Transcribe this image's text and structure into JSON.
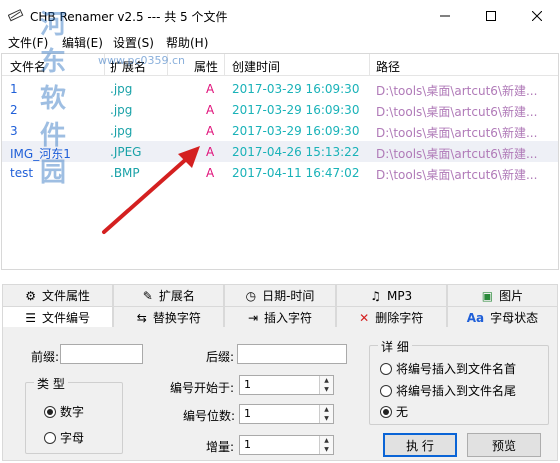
{
  "window": {
    "title": "CHB Renamer v2.5 --- 共 5 个文件",
    "minimize": "—",
    "maximize": "☐",
    "close": "✕"
  },
  "menu": [
    {
      "label": "文件(F)"
    },
    {
      "label": "编辑(E)"
    },
    {
      "label": "设置(S)"
    },
    {
      "label": "帮助(H)"
    }
  ],
  "watermark": {
    "text": "河东软件园",
    "url": "www.pc0359.cn"
  },
  "file_list": {
    "columns": [
      "文件名",
      "扩展名",
      "属性",
      "创建时间",
      "路径"
    ],
    "rows": [
      {
        "name": "1",
        "ext": ".jpg",
        "attr": "A",
        "created": "2017-03-29 16:09:30",
        "path": "D:\\tools\\桌面\\artcut6\\新建..."
      },
      {
        "name": "2",
        "ext": ".jpg",
        "attr": "A",
        "created": "2017-03-29 16:09:30",
        "path": "D:\\tools\\桌面\\artcut6\\新建..."
      },
      {
        "name": "3",
        "ext": ".jpg",
        "attr": "A",
        "created": "2017-03-29 16:09:30",
        "path": "D:\\tools\\桌面\\artcut6\\新建..."
      },
      {
        "name": "IMG_河东1",
        "ext": ".JPEG",
        "attr": "A",
        "created": "2017-04-26 15:13:22",
        "path": "D:\\tools\\桌面\\artcut6\\新建..."
      },
      {
        "name": "test",
        "ext": ".BMP",
        "attr": "A",
        "created": "2017-04-11 16:47:02",
        "path": "D:\\tools\\桌面\\artcut6\\新建..."
      }
    ]
  },
  "tabs_top": [
    {
      "label": "文件属性",
      "icon": "gear-icon"
    },
    {
      "label": "扩展名",
      "icon": "edit-icon"
    },
    {
      "label": "日期-时间",
      "icon": "clock-icon"
    },
    {
      "label": "MP3",
      "icon": "music-icon"
    },
    {
      "label": "图片",
      "icon": "picture-icon"
    }
  ],
  "tabs_bottom": [
    {
      "label": "文件编号",
      "icon": "list-icon",
      "active": true
    },
    {
      "label": "替换字符",
      "icon": "replace-icon"
    },
    {
      "label": "插入字符",
      "icon": "insert-icon"
    },
    {
      "label": "删除字符",
      "icon": "delete-icon"
    },
    {
      "label": "字母状态",
      "icon": "case-icon"
    }
  ],
  "numbering": {
    "prefix_label": "前缀:",
    "suffix_label": "后缀:",
    "type_group": "类 型",
    "type_options": [
      "数字",
      "字母"
    ],
    "type_selected": "数字",
    "start_label": "编号开始于:",
    "start_value": "1",
    "digits_label": "编号位数:",
    "digits_value": "1",
    "step_label": "增量:",
    "step_value": "1",
    "detail_group": "详 细",
    "detail_options": [
      "将编号插入到文件名首",
      "将编号插入到文件名尾",
      "无"
    ],
    "detail_selected": "无",
    "run_label": "执 行",
    "preview_label": "预览"
  },
  "colors": {
    "name": "#1f5fd8",
    "ext": "#1aa2a8",
    "attr": "#e0107a",
    "time": "#19b2b8",
    "path": "#b07ab8",
    "arrow": "#d42020"
  }
}
